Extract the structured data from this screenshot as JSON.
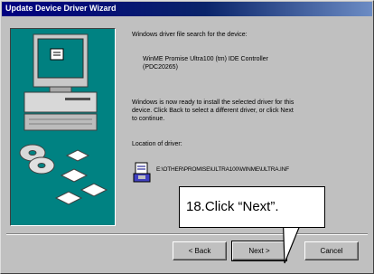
{
  "window": {
    "title": "Update Device Driver Wizard"
  },
  "content": {
    "search_text": "Windows driver file search for the device:",
    "device_name_line1": "WinME Promise Ultra100 (tm) IDE Controller",
    "device_name_line2": "(PDC20265)",
    "ready_text_line1": "Windows is now ready to install the selected driver for this",
    "ready_text_line2": "device. Click Back to select a different driver, or click Next",
    "ready_text_line3": "to continue.",
    "location_label": "Location of driver:",
    "driver_path": "E:\\OTHER\\PROMISE\\ULTRA100\\WINME\\ULTRA.INF"
  },
  "buttons": {
    "back_label": "< Back",
    "next_label": "Next >",
    "cancel_label": "Cancel"
  },
  "callout": {
    "text": "18.Click “Next”."
  },
  "colors": {
    "title_bar": "#000080",
    "art_panel": "#008282",
    "dialog_face": "#c0c0c0"
  },
  "icons": [
    "computer-icon",
    "cd-disc-icon",
    "floppy-disk-icon",
    "driver-file-icon"
  ]
}
